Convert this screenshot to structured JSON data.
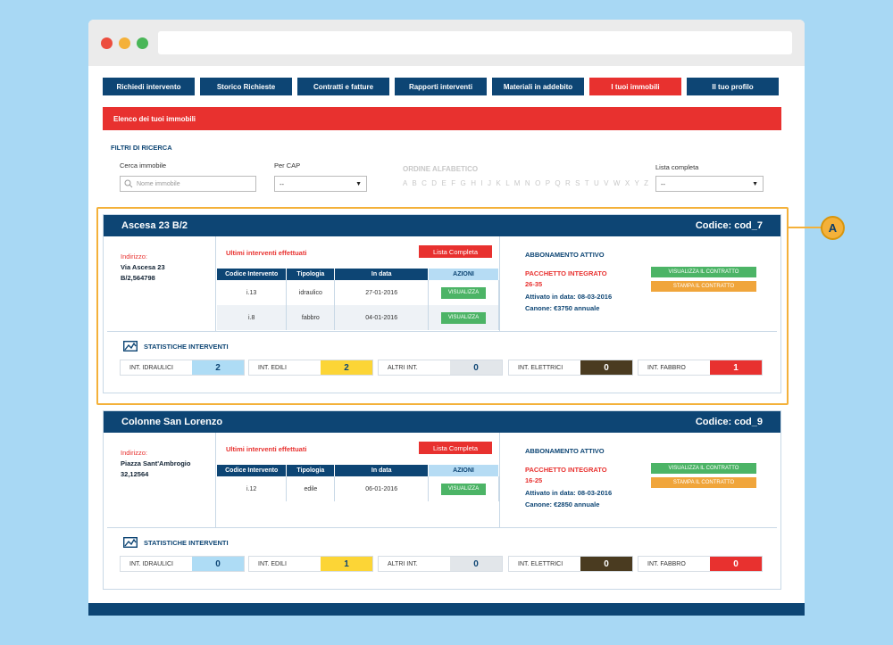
{
  "colors": {
    "navy": "#0d4574",
    "red": "#e8312f",
    "green": "#4cb466",
    "orange": "#f0a53b",
    "callout": "#f4b13a"
  },
  "nav": [
    {
      "label": "Richiedi intervento",
      "active": false
    },
    {
      "label": "Storico Richieste",
      "active": false
    },
    {
      "label": "Contratti e fatture",
      "active": false
    },
    {
      "label": "Rapporti interventi",
      "active": false
    },
    {
      "label": "Materiali in addebito",
      "active": false
    },
    {
      "label": "I tuoi immobili",
      "active": true
    },
    {
      "label": "Il tuo profilo",
      "active": false
    }
  ],
  "section_title": "Elenco dei tuoi immobili",
  "filters": {
    "title": "FILTRI DI RICERCA",
    "search_label": "Cerca immobile",
    "search_placeholder": "Nome immobile",
    "search_icon": "search-icon",
    "cap_label": "Per CAP",
    "cap_value": "--",
    "alpha_title": "ORDINE ALFABETICO",
    "alphabet": "A B C D E F G H I J K L M N O P Q R S T U V W X Y Z",
    "list_label": "Lista completa",
    "list_value": "--"
  },
  "callout": {
    "label": "A"
  },
  "cards": [
    {
      "name": "Ascesa 23 B/2",
      "code": "Codice: cod_7",
      "address_label": "Indirizzo:",
      "address_line1": "Via Ascesa 23",
      "address_line2": "B/2,564798",
      "interventions_title": "Ultimi interventi effettuati",
      "full_list_btn": "Lista Completa",
      "table_headers": [
        "Codice Intervento",
        "Tipologia",
        "In data",
        "AZIONI"
      ],
      "rows": [
        {
          "code": "i.13",
          "type": "idraulico",
          "date": "27-01-2016",
          "action": "VISUALIZZA"
        },
        {
          "code": "i.8",
          "type": "fabbro",
          "date": "04-01-2016",
          "action": "VISUALIZZA"
        }
      ],
      "subscription_title": "ABBONAMENTO ATTIVO",
      "package_name": "PACCHETTO INTEGRATO",
      "package_code": "26-35",
      "activated": "Attivato in data: 08-03-2016",
      "fee": "Canone: €3750 annuale",
      "view_contract_btn": "VISUALIZZA IL CONTRATTO",
      "print_contract_btn": "STAMPA IL CONTRATTO",
      "stats_title": "STATISTICHE INTERVENTI",
      "stats": [
        {
          "label": "INT. IDRAULICI",
          "value": "2",
          "color": "#aedcf5",
          "text": "#0d4574"
        },
        {
          "label": "INT. EDILI",
          "value": "2",
          "color": "#fcd536",
          "text": "#0d4574"
        },
        {
          "label": "ALTRI INT.",
          "value": "0",
          "color": "#e2e6ea",
          "text": "#0d4574"
        },
        {
          "label": "INT. ELETTRICI",
          "value": "0",
          "color": "#4a3b20",
          "text": "#ffffff"
        },
        {
          "label": "INT. FABBRO",
          "value": "1",
          "color": "#e8312f",
          "text": "#ffffff"
        }
      ]
    },
    {
      "name": "Colonne San Lorenzo",
      "code": "Codice: cod_9",
      "address_label": "Indirizzo:",
      "address_line1": "Piazza Sant'Ambrogio",
      "address_line2": "32,12564",
      "interventions_title": "Ultimi interventi effettuati",
      "full_list_btn": "Lista Completa",
      "table_headers": [
        "Codice Intervento",
        "Tipologia",
        "In data",
        "AZIONI"
      ],
      "rows": [
        {
          "code": "i.12",
          "type": "edile",
          "date": "06-01-2016",
          "action": "VISUALIZZA"
        }
      ],
      "subscription_title": "ABBONAMENTO ATTIVO",
      "package_name": "PACCHETTO INTEGRATO",
      "package_code": "16-25",
      "activated": "Attivato in data: 08-03-2016",
      "fee": "Canone: €2850 annuale",
      "view_contract_btn": "VISUALIZZA IL CONTRATTO",
      "print_contract_btn": "STAMPA IL CONTRATTO",
      "stats_title": "STATISTICHE INTERVENTI",
      "stats": [
        {
          "label": "INT. IDRAULICI",
          "value": "0",
          "color": "#aedcf5",
          "text": "#0d4574"
        },
        {
          "label": "INT. EDILI",
          "value": "1",
          "color": "#fcd536",
          "text": "#0d4574"
        },
        {
          "label": "ALTRI INT.",
          "value": "0",
          "color": "#e2e6ea",
          "text": "#0d4574"
        },
        {
          "label": "INT. ELETTRICI",
          "value": "0",
          "color": "#4a3b20",
          "text": "#ffffff"
        },
        {
          "label": "INT. FABBRO",
          "value": "0",
          "color": "#e8312f",
          "text": "#ffffff"
        }
      ]
    }
  ]
}
